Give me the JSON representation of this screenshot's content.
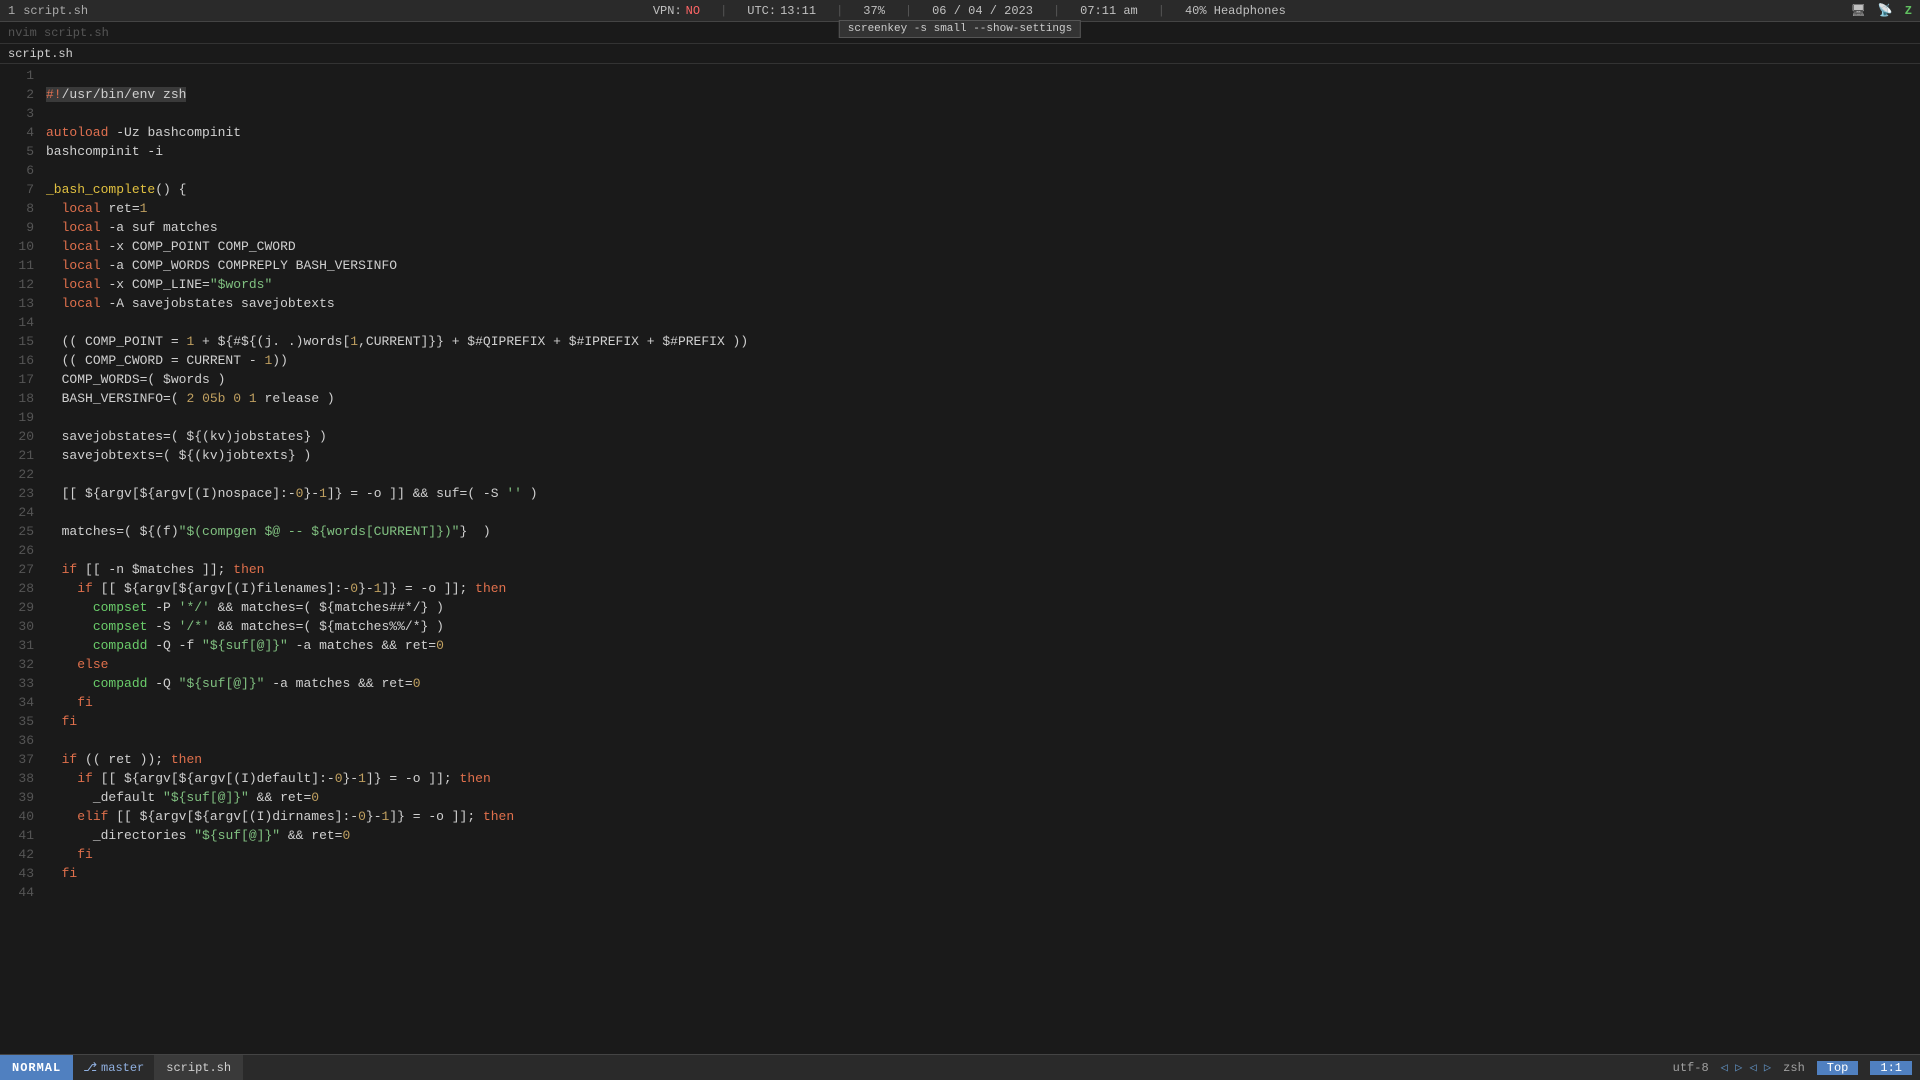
{
  "topbar": {
    "window_num": "1",
    "file_ref": "script.sh",
    "vpn_label": "VPN:",
    "vpn_status": "NO",
    "utc_label": "UTC:",
    "utc_time": "13:11",
    "battery": "37%",
    "date": "06 / 04 / 2023",
    "time": "07:11 am",
    "volume": "40% Headphones",
    "screenkey_text": "screenkey -s small --show-settings"
  },
  "file_title": "script.sh",
  "lines": [
    {
      "num": 1,
      "content": "#!/usr/bin/env zsh",
      "cursor": true
    },
    {
      "num": 2,
      "content": ""
    },
    {
      "num": 3,
      "content": "autoload -Uz bashcompinit"
    },
    {
      "num": 4,
      "content": "bashcompinit -i"
    },
    {
      "num": 5,
      "content": ""
    },
    {
      "num": 6,
      "content": "_bash_complete() {"
    },
    {
      "num": 7,
      "content": "  local ret=1"
    },
    {
      "num": 8,
      "content": "  local -a suf matches"
    },
    {
      "num": 9,
      "content": "  local -x COMP_POINT COMP_CWORD"
    },
    {
      "num": 10,
      "content": "  local -a COMP_WORDS COMPREPLY BASH_VERSINFO"
    },
    {
      "num": 11,
      "content": "  local -x COMP_LINE=\"$words\""
    },
    {
      "num": 12,
      "content": "  local -A savejobstates savejobtexts"
    },
    {
      "num": 13,
      "content": ""
    },
    {
      "num": 14,
      "content": "  (( COMP_POINT = 1 + ${#${(j. .)words[1,CURRENT]}} + $#QIPREFIX + $#IPREFIX + $#PREFIX ))"
    },
    {
      "num": 15,
      "content": "  (( COMP_CWORD = CURRENT - 1))"
    },
    {
      "num": 16,
      "content": "  COMP_WORDS=( $words )"
    },
    {
      "num": 17,
      "content": "  BASH_VERSINFO=( 2 05b 0 1 release )"
    },
    {
      "num": 18,
      "content": ""
    },
    {
      "num": 19,
      "content": "  savejobstates=( ${(kv)jobstates} )"
    },
    {
      "num": 20,
      "content": "  savejobtexts=( ${(kv)jobtexts} )"
    },
    {
      "num": 21,
      "content": ""
    },
    {
      "num": 22,
      "content": "  [[ ${argv[${argv[(I)nospace]:-0}-1]} = -o ]] && suf=( -S '' )"
    },
    {
      "num": 23,
      "content": ""
    },
    {
      "num": 24,
      "content": "  matches=( ${(f)\"$(compgen $@ -- ${words[CURRENT]})\"}  )"
    },
    {
      "num": 25,
      "content": ""
    },
    {
      "num": 26,
      "content": "  if [[ -n $matches ]]; then"
    },
    {
      "num": 27,
      "content": "    if [[ ${argv[${argv[(I)filenames]:-0}-1]} = -o ]]; then"
    },
    {
      "num": 28,
      "content": "      compset -P '*/' && matches=( ${matches##*/} )"
    },
    {
      "num": 29,
      "content": "      compset -S '/*' && matches=( ${matches%%/*} )"
    },
    {
      "num": 30,
      "content": "      compadd -Q -f \"${suf[@]}\" -a matches && ret=0"
    },
    {
      "num": 31,
      "content": "    else"
    },
    {
      "num": 32,
      "content": "      compadd -Q \"${suf[@]}\" -a matches && ret=0"
    },
    {
      "num": 33,
      "content": "    fi"
    },
    {
      "num": 34,
      "content": "  fi"
    },
    {
      "num": 35,
      "content": ""
    },
    {
      "num": 36,
      "content": "  if (( ret )); then"
    },
    {
      "num": 37,
      "content": "    if [[ ${argv[${argv[(I)default]:-0}-1]} = -o ]]; then"
    },
    {
      "num": 38,
      "content": "      _default \"${suf[@]}\" && ret=0"
    },
    {
      "num": 39,
      "content": "    elif [[ ${argv[${argv[(I)dirnames]:-0}-1]} = -o ]]; then"
    },
    {
      "num": 40,
      "content": "      _directories \"${suf[@]}\" && ret=0"
    },
    {
      "num": 41,
      "content": "    fi"
    },
    {
      "num": 42,
      "content": "  fi"
    },
    {
      "num": 43,
      "content": ""
    },
    {
      "num": 44,
      "content": ""
    }
  ],
  "bottombar": {
    "mode": "NORMAL",
    "branch_icon": "⎇",
    "branch": "master",
    "file": "script.sh",
    "encoding": "utf-8",
    "arrows": "◁ ▷ ◁ ▷",
    "filetype": "zsh",
    "position": "Top",
    "line_col": "1:1"
  }
}
